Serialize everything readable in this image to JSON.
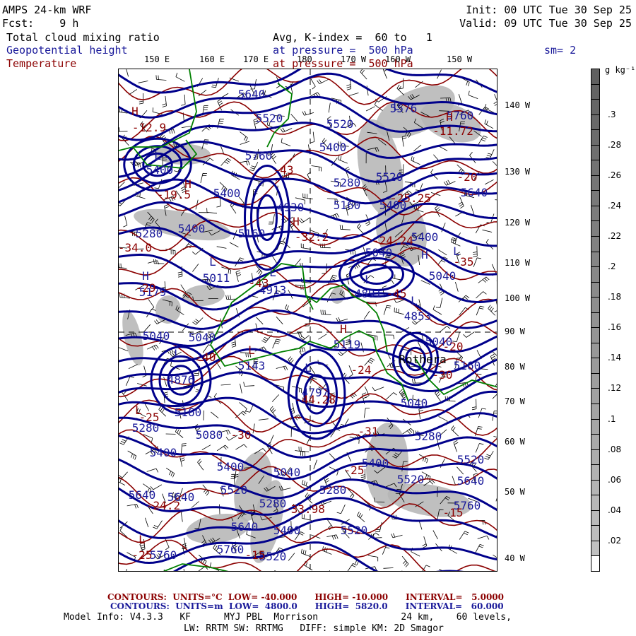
{
  "header": {
    "model": "AMPS 24-km WRF",
    "forecast": "Fcst:    9 h",
    "init": "Init: 00 UTC Tue 30 Sep 25",
    "valid": "Valid: 09 UTC Tue 30 Sep 25",
    "field_shaded": "Total cloud mixing ratio",
    "field_blue": "Geopotential height",
    "field_red": "Temperature",
    "avg": "Avg, K-index =  60 to   1",
    "pressure_blue": "at pressure =  500 hPa",
    "pressure_red": "at pressure =  500 hPa",
    "smoothing": "sm= 2"
  },
  "axes": {
    "top": [
      "150 E",
      "160 E",
      "170 E",
      "180",
      "170 W",
      "160 W",
      "150 W"
    ],
    "right": [
      "140 W",
      "130 W",
      "120 W",
      "110 W",
      "100 W",
      "90 W",
      "80 W",
      "70 W",
      "60 W",
      "50 W",
      "40 W"
    ]
  },
  "colorbar": {
    "units": "g kg⁻¹",
    "labels": [
      ".02",
      ".04",
      ".06",
      ".08",
      ".1",
      ".12",
      ".14",
      ".16",
      ".18",
      ".2",
      ".22",
      ".24",
      ".26",
      ".28",
      ".3"
    ]
  },
  "map": {
    "station": "Rothera",
    "height_labels": [
      "5640",
      "5520",
      "5520",
      "5400",
      "5760",
      "5576",
      "5760",
      "5400",
      "5400",
      "5280",
      "5520",
      "5640",
      "4930",
      "5160",
      "5400",
      "5280",
      "5400",
      "5160",
      "5400",
      "5040",
      "5040",
      "5011",
      "4913",
      "4891",
      "4853",
      "5179",
      "5040",
      "5040",
      "5119",
      "5040",
      "4876",
      "5143",
      "5160",
      "4797",
      "5160",
      "5040",
      "5280",
      "5080",
      "5280",
      "5400",
      "5400",
      "5520",
      "5040",
      "5400",
      "5520",
      "5520",
      "5640",
      "5280",
      "5280",
      "5640",
      "5640",
      "5760",
      "5640",
      "5400",
      "5520",
      "5760",
      "5760",
      "5520"
    ],
    "temp_labels": [
      "-12.9",
      "-19.5",
      "-32.2",
      "-34.0",
      "-43",
      "-29",
      "-45",
      "-40",
      "-24",
      "-44.28",
      "-25",
      "-30",
      "-25",
      "-31",
      "-24.2",
      "-33.98",
      "-25",
      "-15",
      "-11.72",
      "-25.25",
      "-24.24",
      "-35",
      "-20",
      "-43",
      "-20",
      "-30",
      "-15"
    ],
    "pressure_centers_blue": [
      "L",
      "L",
      "L",
      "L",
      "L",
      "L",
      "L",
      "H",
      "H",
      "L",
      "L"
    ],
    "pressure_centers_red": [
      "H",
      "H",
      "H",
      "H",
      "L",
      "L",
      "H",
      "L"
    ]
  },
  "footer": {
    "temp_contours": "CONTOURS:  UNITS=°C  LOW= -40.000      HIGH= -10.000      INTERVAL=   5.0000",
    "height_contours": "CONTOURS:  UNITS=m  LOW=  4800.0      HIGH=  5820.0      INTERVAL=   60.000",
    "model_info": "Model Info: V4.3.3   KF      MYJ PBL  Morrison               24 km,    60 levels,",
    "physics": "LW: RRTM SW: RRTMG   DIFF: simple KM: 2D Smagor"
  },
  "colors": {
    "height": "#00008b",
    "temp": "#8b0000",
    "coast": "#008000",
    "cloud": "#b4b4b4"
  }
}
